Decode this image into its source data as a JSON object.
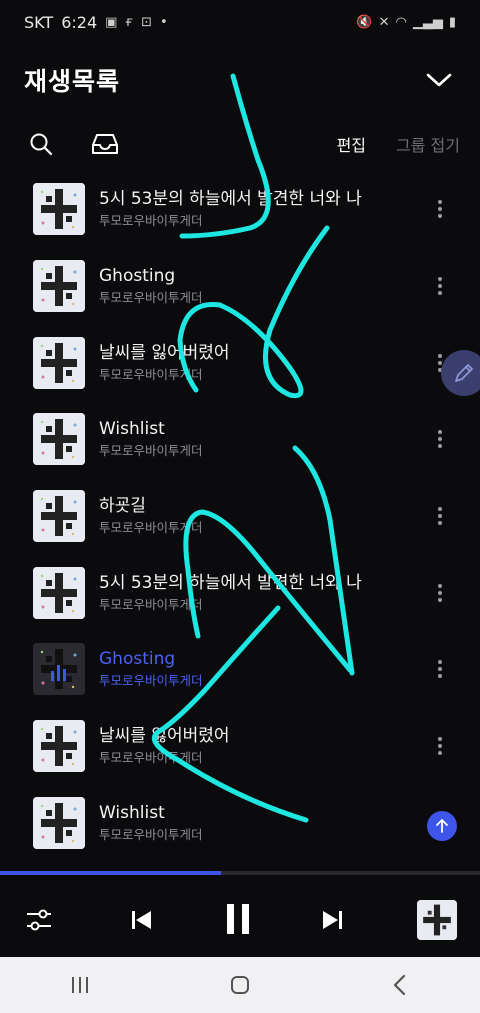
{
  "status": {
    "carrier": "SKT",
    "time": "6:24",
    "left_icons": [
      "gallery-icon",
      "f-app-icon",
      "g-app-icon",
      "dot-icon"
    ],
    "right_icons": [
      "mute-icon",
      "vibrate-icon",
      "wifi-icon",
      "signal-icon",
      "battery-icon"
    ]
  },
  "header": {
    "title": "재생목록"
  },
  "toolbar": {
    "edit_label": "편집",
    "group_label": "그룹 접기"
  },
  "tracks": [
    {
      "title": "5시 53분의 하늘에서 발견한 너와 나",
      "artist": "투모로우바이투게더",
      "active": false
    },
    {
      "title": "Ghosting",
      "artist": "투모로우바이투게더",
      "active": false
    },
    {
      "title": "날씨를 잃어버렸어",
      "artist": "투모로우바이투게더",
      "active": false
    },
    {
      "title": "Wishlist",
      "artist": "투모로우바이투게더",
      "active": false
    },
    {
      "title": "하굣길",
      "artist": "투모로우바이투게더",
      "active": false
    },
    {
      "title": "5시 53분의 하늘에서 발견한 너와 나",
      "artist": "투모로우바이투게더",
      "active": false
    },
    {
      "title": "Ghosting",
      "artist": "투모로우바이투게더",
      "active": true
    },
    {
      "title": "날씨를 잃어버렸어",
      "artist": "투모로우바이투게더",
      "active": false
    },
    {
      "title": "Wishlist",
      "artist": "투모로우바이투게더",
      "active": false
    }
  ],
  "player": {
    "progress": 0.46
  },
  "colors": {
    "accent": "#3d55e8",
    "active_text": "#4b62f2",
    "scribble": "#1ee7e2"
  }
}
